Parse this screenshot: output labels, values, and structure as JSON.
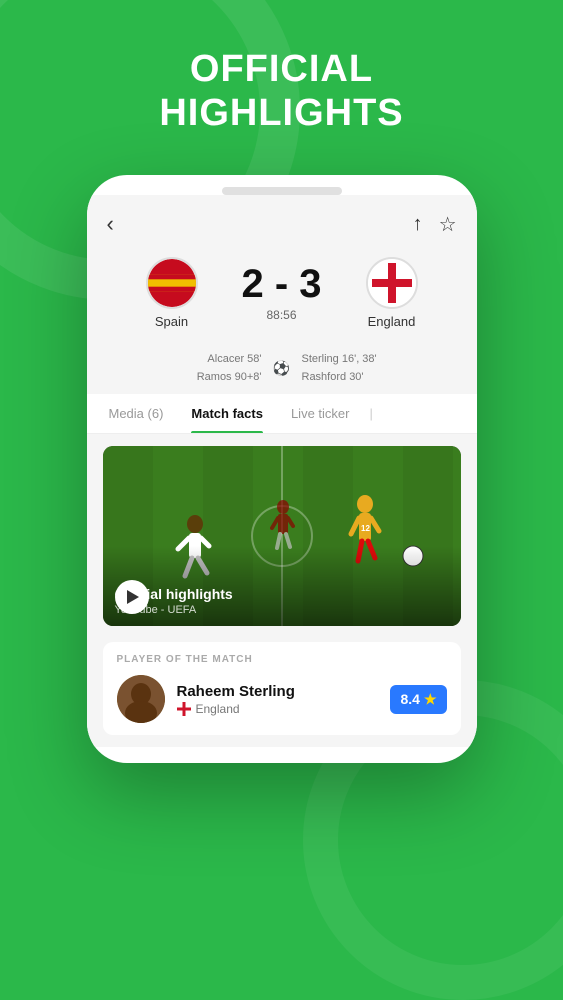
{
  "header": {
    "line1": "OFFICIAL",
    "line2": "HIGHLIGHTS"
  },
  "match": {
    "team_home": "Spain",
    "team_away": "England",
    "score_home": "2",
    "score_separator": "-",
    "score_away": "3",
    "match_time": "88:56",
    "goals_home": [
      "Alcacer 58'",
      "Ramos 90+8'"
    ],
    "goals_away": [
      "Sterling 16', 38'",
      "Rashford 30'"
    ],
    "soccer_ball": "⚽"
  },
  "tabs": [
    {
      "label": "Media (6)",
      "active": false
    },
    {
      "label": "Match facts",
      "active": true
    },
    {
      "label": "Live ticker",
      "active": false
    }
  ],
  "video": {
    "title": "Official highlights",
    "source": "YouTube - UEFA"
  },
  "potm": {
    "label": "PLAYER OF THE MATCH",
    "name": "Raheem Sterling",
    "country": "England",
    "rating": "8.4"
  },
  "nav": {
    "back_arrow": "‹",
    "share_icon": "↑",
    "star_icon": "☆"
  }
}
